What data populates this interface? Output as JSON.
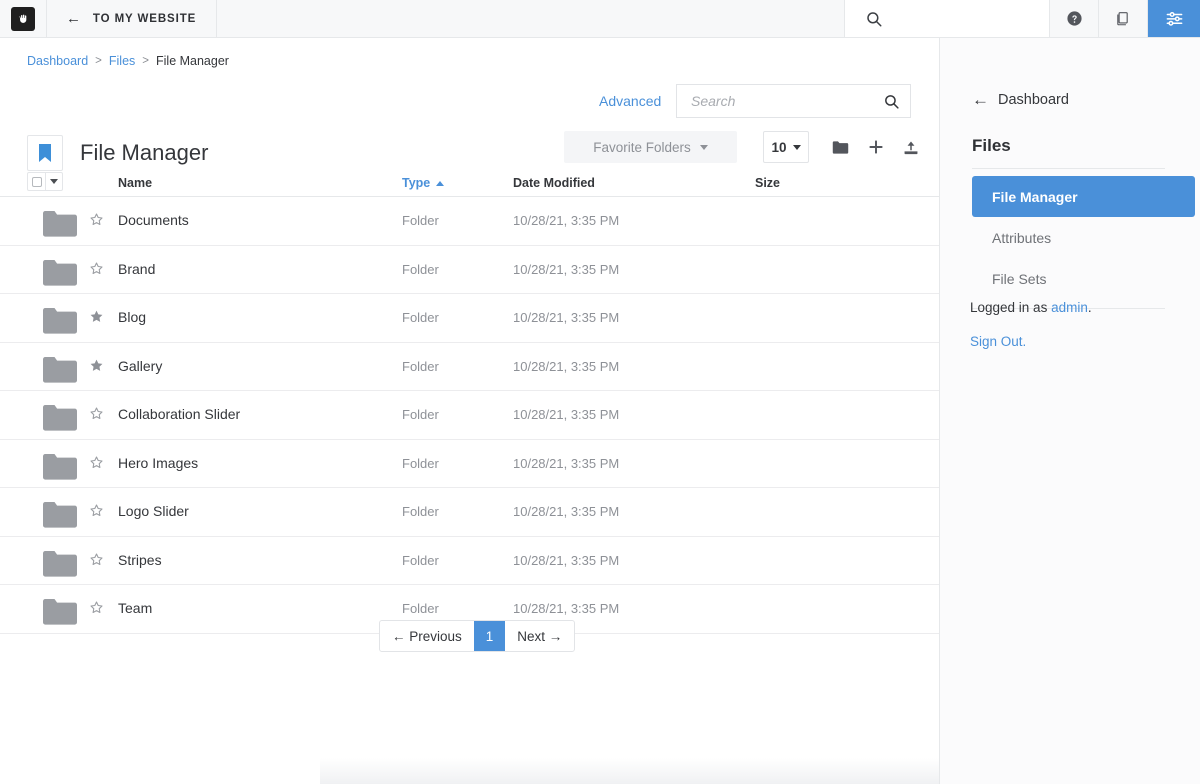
{
  "topbar": {
    "logo_name": "concrete-cms-logo",
    "to_site_label": "TO MY WEBSITE",
    "search_icon": "search-icon",
    "help_icon": "help-circle-icon",
    "clipboard_icon": "clipboard-copy-icon",
    "settings_icon": "sliders-settings-icon",
    "accent_color": "#4a90d9"
  },
  "breadcrumb": {
    "items": [
      {
        "label": "Dashboard",
        "link": true
      },
      {
        "label": "Files",
        "link": true
      },
      {
        "label": "File Manager",
        "link": false
      }
    ],
    "separator": ">"
  },
  "toolbar": {
    "advanced_label": "Advanced",
    "search_placeholder": "Search",
    "search_value": "",
    "search_icon": "search-icon",
    "favorite_folders_label": "Favorite Folders",
    "per_page_value": "10",
    "new_folder_icon": "folder-icon",
    "add_icon": "plus-icon",
    "upload_icon": "upload-icon"
  },
  "page": {
    "title": "File Manager",
    "title_icon": "bookmark-icon"
  },
  "table": {
    "columns": {
      "name": "Name",
      "type": "Type",
      "date_modified": "Date Modified",
      "size": "Size"
    },
    "sorted_column": "Type",
    "sort_direction": "asc",
    "select_all_icon": "checkbox-icon",
    "select_dropdown_icon": "chevron-down-icon",
    "rows": [
      {
        "name": "Documents",
        "type": "Folder",
        "date": "10/28/21, 3:35 PM",
        "size": "",
        "favorite": false,
        "icon": "folder-icon"
      },
      {
        "name": "Brand",
        "type": "Folder",
        "date": "10/28/21, 3:35 PM",
        "size": "",
        "favorite": false,
        "icon": "folder-icon"
      },
      {
        "name": "Blog",
        "type": "Folder",
        "date": "10/28/21, 3:35 PM",
        "size": "",
        "favorite": true,
        "icon": "folder-icon"
      },
      {
        "name": "Gallery",
        "type": "Folder",
        "date": "10/28/21, 3:35 PM",
        "size": "",
        "favorite": true,
        "icon": "folder-icon"
      },
      {
        "name": "Collaboration Slider",
        "type": "Folder",
        "date": "10/28/21, 3:35 PM",
        "size": "",
        "favorite": false,
        "icon": "folder-icon"
      },
      {
        "name": "Hero Images",
        "type": "Folder",
        "date": "10/28/21, 3:35 PM",
        "size": "",
        "favorite": false,
        "icon": "folder-icon"
      },
      {
        "name": "Logo Slider",
        "type": "Folder",
        "date": "10/28/21, 3:35 PM",
        "size": "",
        "favorite": false,
        "icon": "folder-icon"
      },
      {
        "name": "Stripes",
        "type": "Folder",
        "date": "10/28/21, 3:35 PM",
        "size": "",
        "favorite": false,
        "icon": "folder-icon"
      },
      {
        "name": "Team",
        "type": "Folder",
        "date": "10/28/21, 3:35 PM",
        "size": "",
        "favorite": false,
        "icon": "folder-icon"
      }
    ]
  },
  "pagination": {
    "previous_label": "← Previous",
    "current_page": "1",
    "next_label": "Next →"
  },
  "right_panel": {
    "back_label": "Dashboard",
    "back_icon": "arrow-left-icon",
    "section_title": "Files",
    "items": [
      {
        "label": "File Manager",
        "active": true
      },
      {
        "label": "Attributes",
        "active": false
      },
      {
        "label": "File Sets",
        "active": false
      }
    ],
    "logged_in_prefix": "Logged in as ",
    "logged_in_user": "admin",
    "logged_in_suffix": ".",
    "sign_out_label": "Sign Out."
  }
}
